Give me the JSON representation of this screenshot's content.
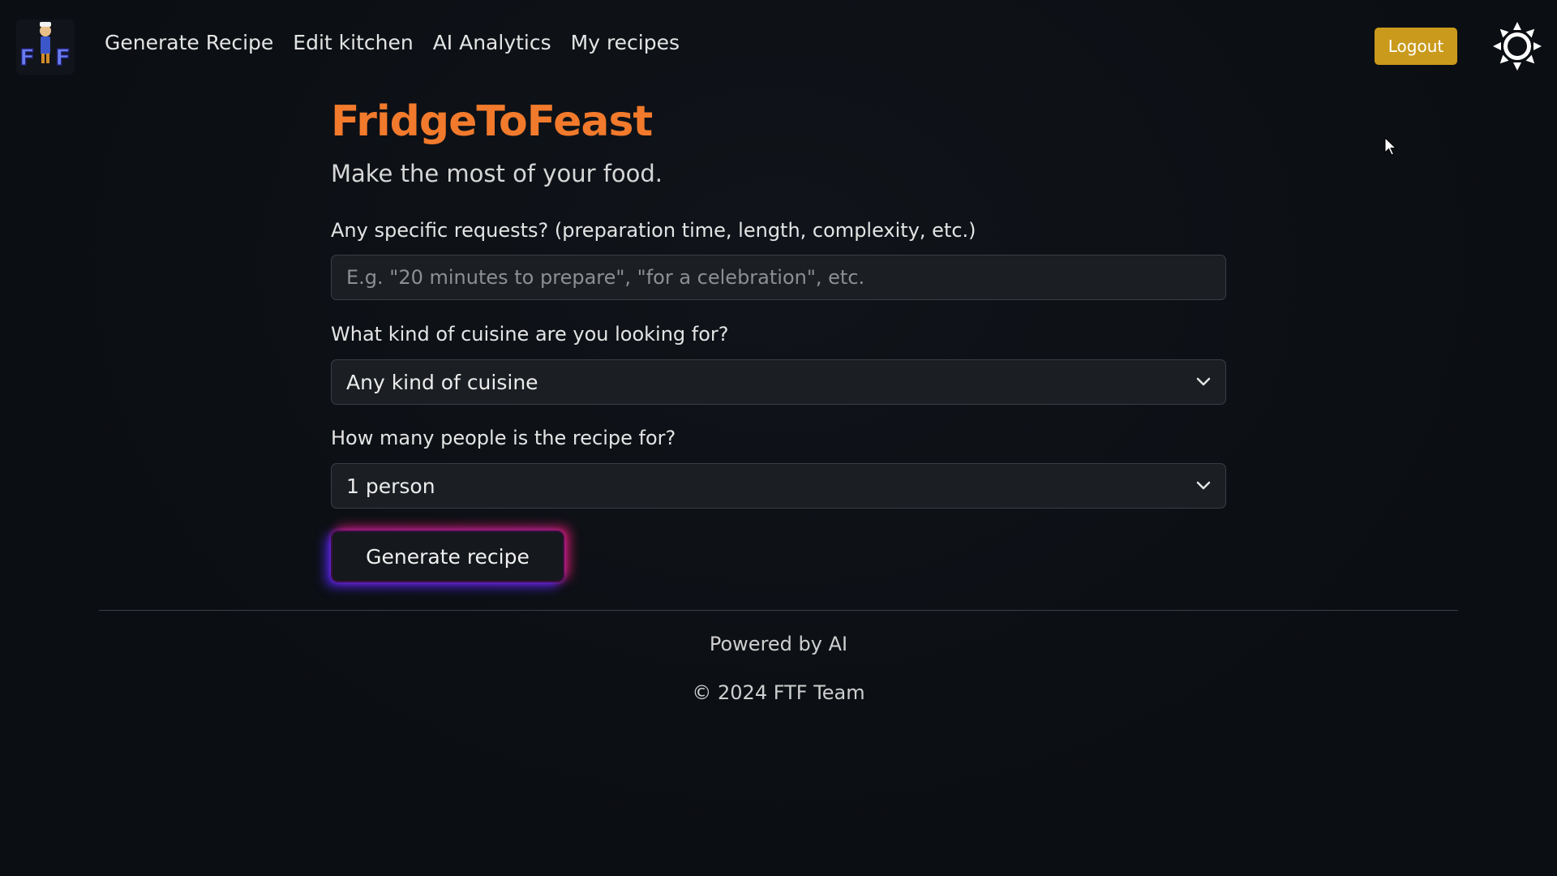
{
  "nav": {
    "logo_text": "FTF",
    "links": [
      {
        "label": "Generate Recipe"
      },
      {
        "label": "Edit kitchen"
      },
      {
        "label": "AI Analytics"
      },
      {
        "label": "My recipes"
      }
    ],
    "logout_label": "Logout",
    "logout_color": "#c99a1c",
    "theme_icon": "sun-icon"
  },
  "main": {
    "title": "FridgeToFeast",
    "title_color": "#f27a2c",
    "subtitle": "Make the most of your food.",
    "requests_label": "Any specific requests? (preparation time, length, complexity, etc.)",
    "requests_placeholder": "E.g. \"20 minutes to prepare\", \"for a celebration\", etc.",
    "requests_value": "",
    "cuisine_label": "What kind of cuisine are you looking for?",
    "cuisine_selected": "Any kind of cuisine",
    "people_label": "How many people is the recipe for?",
    "people_selected": "1 person",
    "generate_label": "Generate recipe"
  },
  "footer": {
    "powered": "Powered by AI",
    "copyright": "© 2024 FTF Team"
  }
}
